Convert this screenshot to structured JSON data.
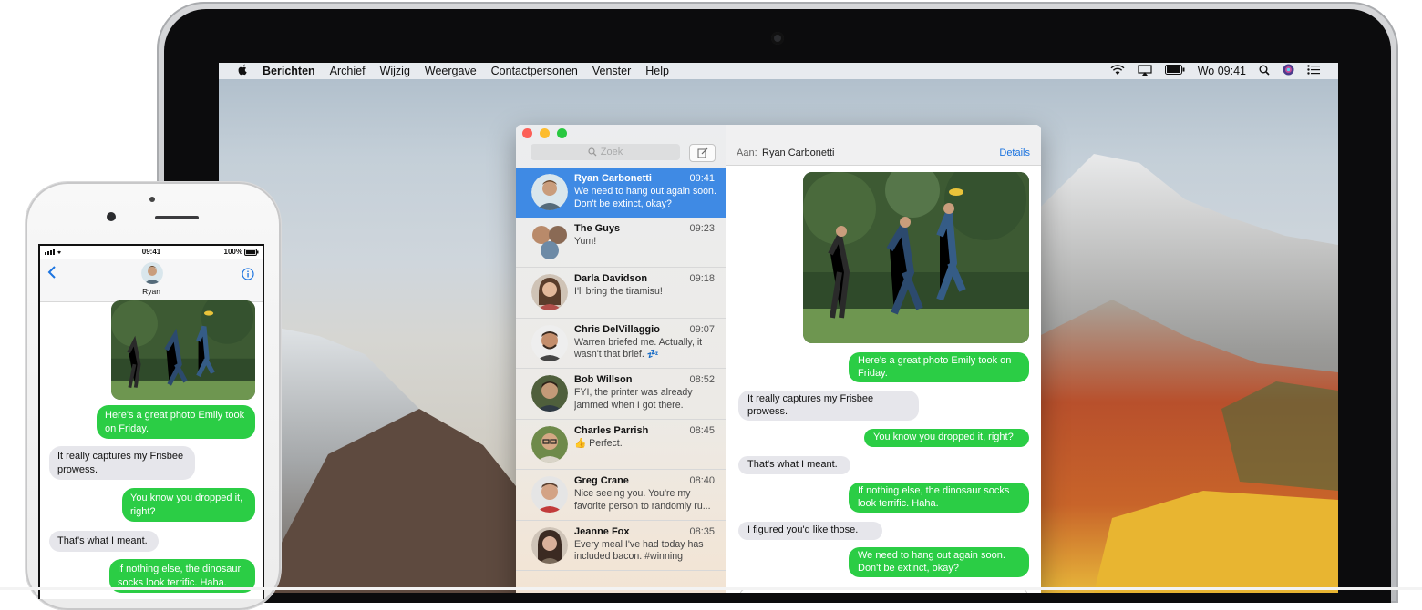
{
  "mac": {
    "menubar": {
      "app": "Berichten",
      "menus": [
        "Archief",
        "Wijzig",
        "Weergave",
        "Contactpersonen",
        "Venster",
        "Help"
      ],
      "clock": "Wo 09:41"
    },
    "messages": {
      "search_placeholder": "Zoek",
      "to_label": "Aan:",
      "recipient": "Ryan Carbonetti",
      "details_label": "Details",
      "conversations": [
        {
          "name": "Ryan Carbonetti",
          "time": "09:41",
          "preview": "We need to hang out again soon. Don't be extinct, okay?"
        },
        {
          "name": "The Guys",
          "time": "09:23",
          "preview": "Yum!"
        },
        {
          "name": "Darla Davidson",
          "time": "09:18",
          "preview": "I'll bring the tiramisu!"
        },
        {
          "name": "Chris DelVillaggio",
          "time": "09:07",
          "preview": "Warren briefed me. Actually, it wasn't that brief. 💤"
        },
        {
          "name": "Bob Willson",
          "time": "08:52",
          "preview": "FYI, the printer was already jammed when I got there."
        },
        {
          "name": "Charles Parrish",
          "time": "08:45",
          "preview": "👍 Perfect."
        },
        {
          "name": "Greg Crane",
          "time": "08:40",
          "preview": "Nice seeing you. You're my favorite person to randomly ru..."
        },
        {
          "name": "Jeanne Fox",
          "time": "08:35",
          "preview": "Every meal I've had today has included bacon. #winning"
        }
      ],
      "chat": [
        {
          "from": "me",
          "text": "Here's a great photo Emily took on Friday."
        },
        {
          "from": "them",
          "text": "It really captures my Frisbee prowess."
        },
        {
          "from": "me",
          "text": "You know you dropped it, right?"
        },
        {
          "from": "them",
          "text": "That's what I meant."
        },
        {
          "from": "me",
          "text": "If nothing else, the dinosaur socks look terrific. Haha."
        },
        {
          "from": "them",
          "text": "I figured you'd like those."
        },
        {
          "from": "me",
          "text": "We need to hang out again soon. Don't be extinct, okay?"
        }
      ]
    }
  },
  "iphone": {
    "time": "09:41",
    "battery": "100%",
    "contact": "Ryan",
    "chat": [
      {
        "from": "me",
        "text": "Here's a great photo Emily took on Friday."
      },
      {
        "from": "them",
        "text": "It really captures my Frisbee prowess."
      },
      {
        "from": "me",
        "text": "You know you dropped it, right?"
      },
      {
        "from": "them",
        "text": "That's what I meant."
      },
      {
        "from": "me",
        "text": "If nothing else, the dinosaur socks look terrific. Haha."
      }
    ]
  },
  "colors": {
    "selection_blue": "#3f8ae4",
    "imessage_green": "#2bcd45",
    "received_gray": "#e6e6eb",
    "link_blue": "#1c74e0"
  }
}
